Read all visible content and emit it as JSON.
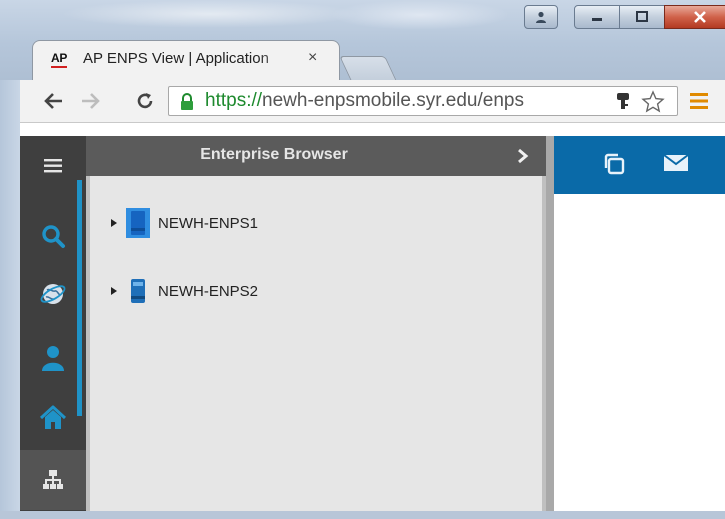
{
  "browser": {
    "tab_favicon": "AP",
    "tab_title": "AP ENPS View | Application",
    "tab_close": "×",
    "url_scheme": "https://",
    "url_rest": "newh-enpsmobile.syr.edu/enps"
  },
  "app": {
    "panel_title": "Enterprise Browser",
    "servers": [
      {
        "label": "NEWH-ENPS1",
        "selected": true
      },
      {
        "label": "NEWH-ENPS2",
        "selected": false
      }
    ],
    "rail_items": [
      "menu-icon",
      "search-icon",
      "globe-icon",
      "user-icon",
      "home-icon",
      "network-icon"
    ]
  },
  "colors": {
    "accent": "#1f93c8",
    "header_blue": "#0a6aa8",
    "rail": "#3f3f3f"
  }
}
